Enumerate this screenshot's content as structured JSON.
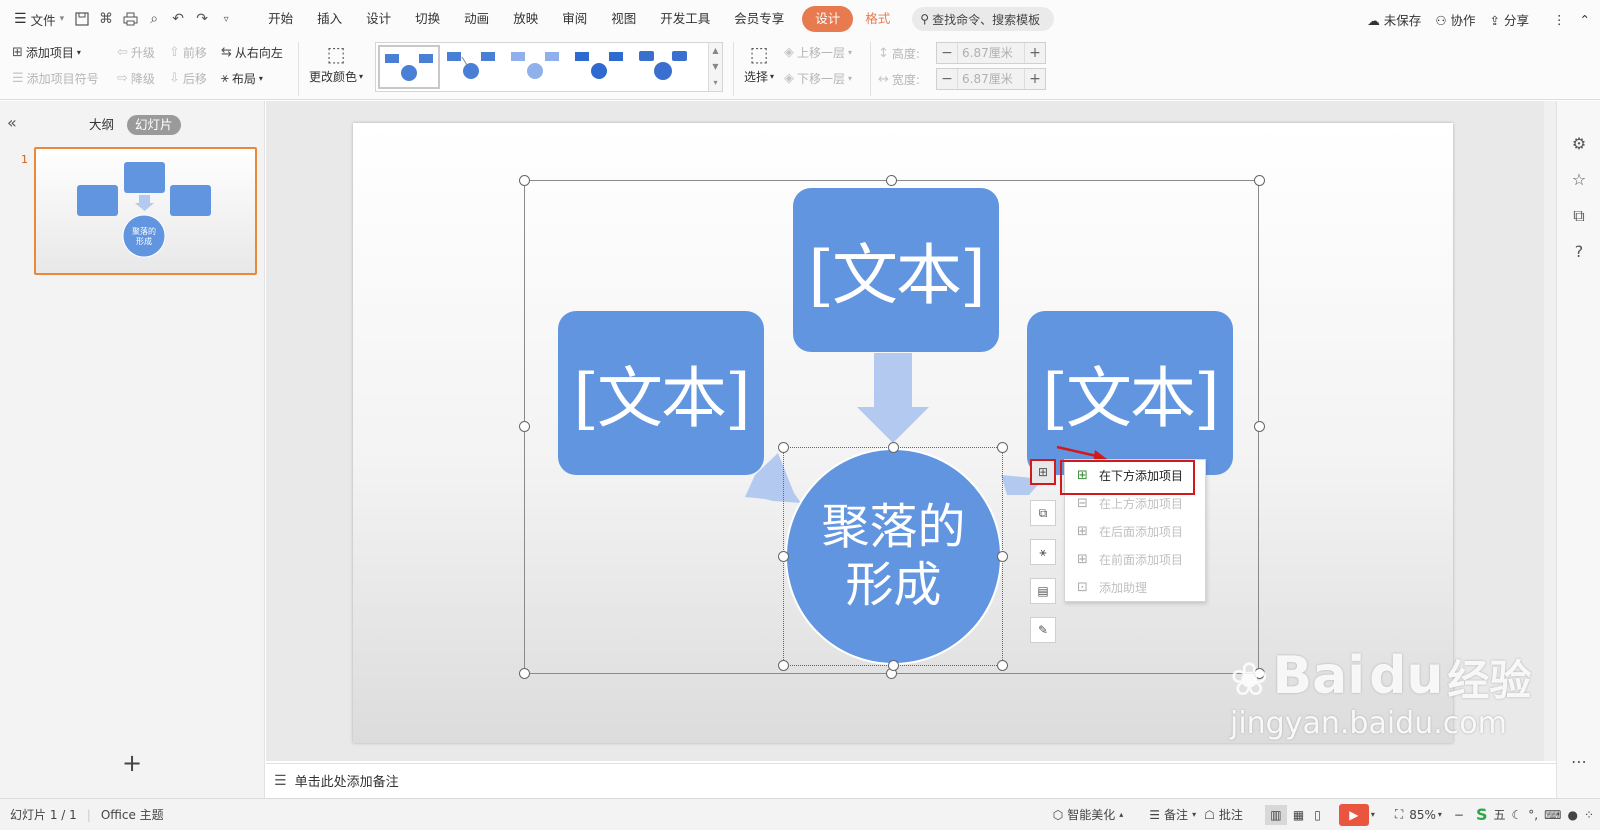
{
  "menubar": {
    "file_label": "文件",
    "tabs": [
      "开始",
      "插入",
      "设计",
      "切换",
      "动画",
      "放映",
      "审阅",
      "视图",
      "开发工具",
      "会员专享"
    ],
    "design_tab": "设计",
    "format_tab": "格式",
    "search_placeholder": "查找命令、搜索模板",
    "unsaved_label": "未保存",
    "collab_label": "协作",
    "share_label": "分享"
  },
  "ribbon": {
    "add_item": "添加项目",
    "add_bullet": "添加项目符号",
    "promote": "升级",
    "demote": "降级",
    "move_forward": "前移",
    "move_back": "后移",
    "rtl": "从右向左",
    "layout": "布局",
    "change_color": "更改颜色",
    "select": "选择",
    "bring_up": "上移一层",
    "send_down": "下移一层",
    "height_label": "高度:",
    "width_label": "宽度:",
    "height_value": "6.87厘米",
    "width_value": "6.87厘米"
  },
  "left_panel": {
    "outline_tab": "大纲",
    "slides_tab": "幻灯片",
    "slide_number": "1",
    "thumb_circle_text": "聚落的形成"
  },
  "diagram": {
    "box_top": "[文本]",
    "box_left": "[文本]",
    "box_right": "[文本]",
    "circle_line1": "聚落的",
    "circle_line2": "形成",
    "fill_color": "#6295e0",
    "arrow_color": "#b3c9f0"
  },
  "context_menu": {
    "items": [
      "在下方添加项目",
      "在上方添加项目",
      "在后面添加项目",
      "在前面添加项目",
      "添加助理"
    ],
    "highlight_color": "#d2191b"
  },
  "notes": {
    "placeholder": "单击此处添加备注"
  },
  "statusbar": {
    "slide_counter": "幻灯片 1 / 1",
    "theme": "Office 主题",
    "smart_beautify": "智能美化",
    "notes": "备注",
    "comments": "批注",
    "zoom": "85%"
  },
  "watermark": {
    "brand": "Bai",
    "brand_suffix": "经验",
    "url": "jingyan.baidu.com"
  }
}
